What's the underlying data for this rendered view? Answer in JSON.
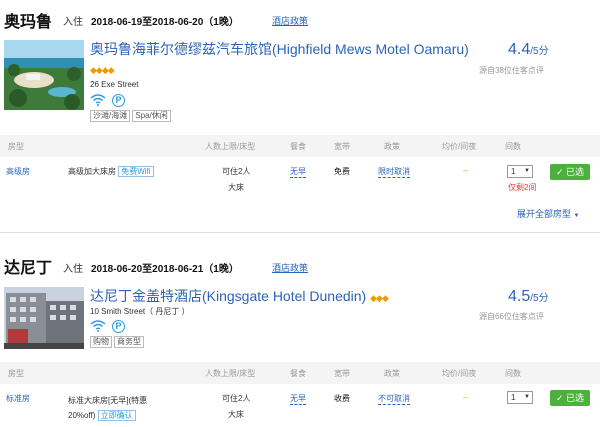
{
  "results": [
    {
      "city": "奥玛鲁",
      "stay_label": "入住",
      "dates": "2018-06-19至2018-06-20（1晚）",
      "policy_link": "酒店政策",
      "hotel_name": "奥玛鲁海菲尔德缪兹汽车旅馆(Highfield Mews Motel Oamaru)",
      "address": "26 Exe Street",
      "tags": [
        "沙滩/海滩",
        "Spa/休闲"
      ],
      "score": "4.4",
      "score_den": "/5分",
      "review_text": "源自38位住客点评",
      "table_headers": [
        "房型",
        "人数上限/床型",
        "餐食",
        "宽带",
        "政策",
        "均价/间夜",
        "间数"
      ],
      "room": {
        "type": "高级房",
        "subtype": "高级加大床房",
        "wifi_tag": "免费Wifi",
        "capacity": "可住2人",
        "bed": "大床",
        "meal": "无早",
        "broadband": "免费",
        "policy": "限时取消",
        "price": "--",
        "qty": "1",
        "button": "✓ 已选",
        "stock_note": "仅剩2间"
      },
      "expand_label": "展开全部房型"
    },
    {
      "city": "达尼丁",
      "stay_label": "入住",
      "dates": "2018-06-20至2018-06-21（1晚）",
      "policy_link": "酒店政策",
      "hotel_name": "达尼丁金盖特酒店(Kingsgate Hotel Dunedin)",
      "address": "10 Smith Street（ 丹尼丁 ）",
      "tags": [
        "购物",
        "商务型"
      ],
      "score": "4.5",
      "score_den": "/5分",
      "review_text": "源自66位住客点评",
      "table_headers": [
        "房型",
        "人数上限/床型",
        "餐食",
        "宽带",
        "政策",
        "均价/间夜",
        "间数"
      ],
      "room": {
        "type": "标准房",
        "subtype_line1": "标准大床房[无早](特惠",
        "subtype_line2": "20%off)",
        "confirm_tag": "立即确认",
        "capacity": "可住2人",
        "bed": "大床",
        "meal": "无早",
        "broadband": "收费",
        "policy": "不可取消",
        "price": "--",
        "qty": "1",
        "button": "✓ 已选"
      }
    }
  ]
}
